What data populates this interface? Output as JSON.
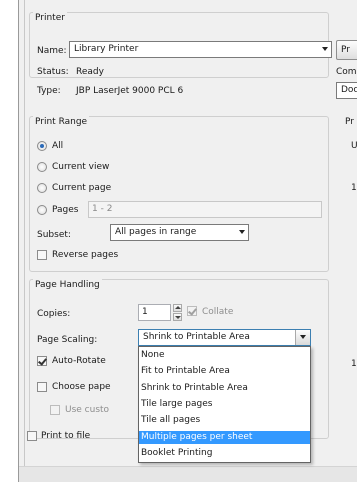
{
  "printer": {
    "group_title": "Printer",
    "name_label": "Name:",
    "name_value": "Library Printer",
    "status_label": "Status:",
    "status_value": "Ready",
    "type_label": "Type:",
    "type_value": "JBP LaserJet 9000 PCL 6",
    "properties_button_partial": "Pr",
    "comments_partial": "Com",
    "doc_combo_partial": "Doc"
  },
  "print_range": {
    "group_title": "Print Range",
    "options": [
      "All",
      "Current view",
      "Current page",
      "Pages"
    ],
    "selected": "All",
    "pages_value": "1 - 2",
    "subset_label": "Subset:",
    "subset_value": "All pages in range",
    "reverse_label": "Reverse pages",
    "reverse_checked": false
  },
  "right_panel": {
    "title_partial": "Pr",
    "label_1": "U",
    "label_2": "1",
    "label_3": "1"
  },
  "page_handling": {
    "group_title": "Page Handling",
    "copies_label": "Copies:",
    "copies_value": "1",
    "collate_label": "Collate",
    "collate_checked": true,
    "scaling_label": "Page Scaling:",
    "scaling_value": "Shrink to Printable Area",
    "auto_rotate_label": "Auto-Rotate",
    "auto_rotate_checked": true,
    "choose_paper_label": "Choose pape",
    "choose_paper_checked": false,
    "use_custom_label": "Use custo",
    "use_custom_checked": false
  },
  "print_to_file": {
    "label": "Print to file",
    "checked": false
  },
  "scaling_dropdown": {
    "options": [
      "None",
      "Fit to Printable Area",
      "Shrink to Printable Area",
      "Tile large pages",
      "Tile all pages",
      "Multiple pages per sheet",
      "Booklet Printing"
    ],
    "highlighted": "Multiple pages per sheet"
  },
  "colors": {
    "highlight": "#3399ff",
    "dialog_bg": "#f0f0f0",
    "focus_border": "#3c7fb1"
  }
}
